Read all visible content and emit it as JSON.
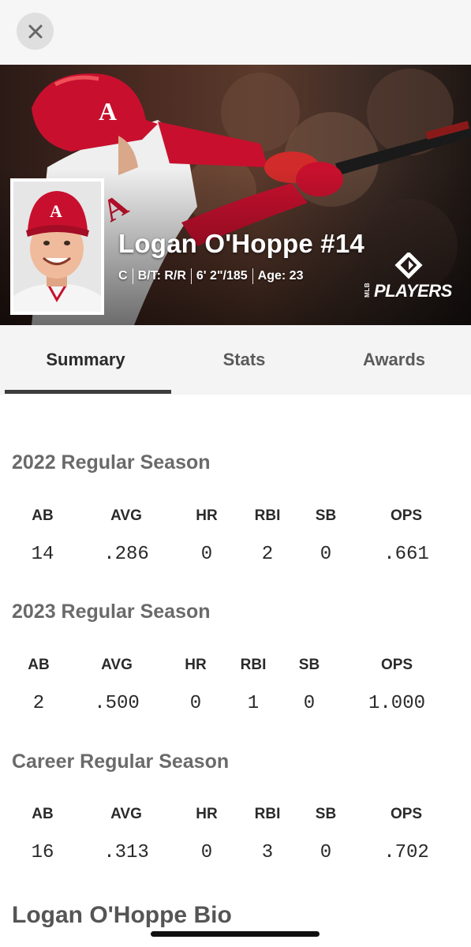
{
  "header": {
    "close_icon": "close-icon"
  },
  "player": {
    "name": "Logan O'Hoppe #14",
    "position": "C",
    "bats_throws": "B/T: R/R",
    "height_weight": "6' 2\"/185",
    "age": "Age: 23",
    "logo_text": "PLAYERS",
    "logo_small": "MLB"
  },
  "tabs": [
    {
      "label": "Summary",
      "active": true
    },
    {
      "label": "Stats",
      "active": false
    },
    {
      "label": "Awards",
      "active": false
    }
  ],
  "sections": [
    {
      "title": "2022 Regular Season",
      "headers": [
        "AB",
        "AVG",
        "HR",
        "RBI",
        "SB",
        "OPS"
      ],
      "values": [
        "14",
        ".286",
        "0",
        "2",
        "0",
        ".661"
      ]
    },
    {
      "title": "2023 Regular Season",
      "headers": [
        "AB",
        "AVG",
        "HR",
        "RBI",
        "SB",
        "OPS"
      ],
      "values": [
        "2",
        ".500",
        "0",
        "1",
        "0",
        "1.000"
      ]
    },
    {
      "title": "Career Regular Season",
      "headers": [
        "AB",
        "AVG",
        "HR",
        "RBI",
        "SB",
        "OPS"
      ],
      "values": [
        "16",
        ".313",
        "0",
        "3",
        "0",
        ".702"
      ]
    }
  ],
  "bio": {
    "title": "Logan O'Hoppe Bio"
  },
  "colors": {
    "angels_red": "#c8102e",
    "text_dark": "#2a2a2a",
    "section_gray": "#6a6a6a"
  }
}
